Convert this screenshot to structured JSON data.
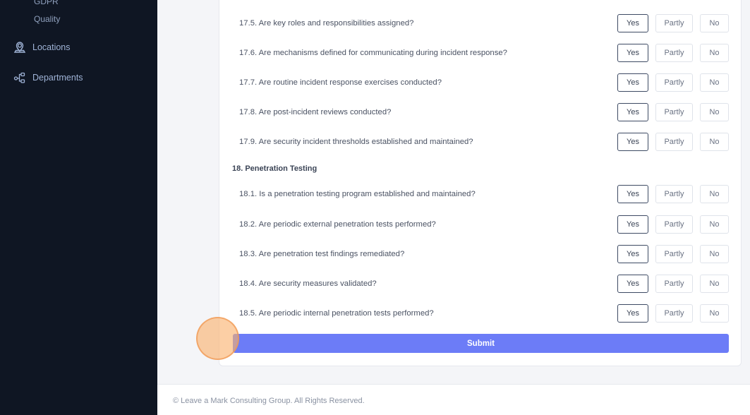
{
  "sidebar": {
    "sub_items": [
      "GDPR",
      "Quality"
    ],
    "nav_items": [
      {
        "label": "Locations",
        "icon": "location-pin-icon"
      },
      {
        "label": "Departments",
        "icon": "hierarchy-icon"
      }
    ]
  },
  "questions_top": [
    {
      "text": "17.5. Are key roles and responsibilities assigned?"
    },
    {
      "text": "17.6. Are mechanisms defined for communicating during incident response?"
    },
    {
      "text": "17.7. Are routine incident response exercises conducted?"
    },
    {
      "text": "17.8. Are post-incident reviews conducted?"
    },
    {
      "text": "17.9. Are security incident thresholds established and maintained?"
    }
  ],
  "section_18": {
    "title": "18. Penetration Testing",
    "questions": [
      {
        "text": "18.1. Is a penetration testing program established and maintained?"
      },
      {
        "text": "18.2. Are periodic external penetration tests performed?"
      },
      {
        "text": "18.3. Are penetration test findings remediated?"
      },
      {
        "text": "18.4. Are security measures validated?"
      },
      {
        "text": "18.5. Are periodic internal penetration tests performed?"
      }
    ]
  },
  "options": {
    "yes": "Yes",
    "partly": "Partly",
    "no": "No"
  },
  "submit_label": "Submit",
  "footer": {
    "text": "© Leave a Mark Consulting Group. All Rights Reserved."
  },
  "colors": {
    "sidebar_bg": "#0f1623",
    "accent": "#6c7cf7",
    "cursor_highlight": "#fab26e"
  }
}
